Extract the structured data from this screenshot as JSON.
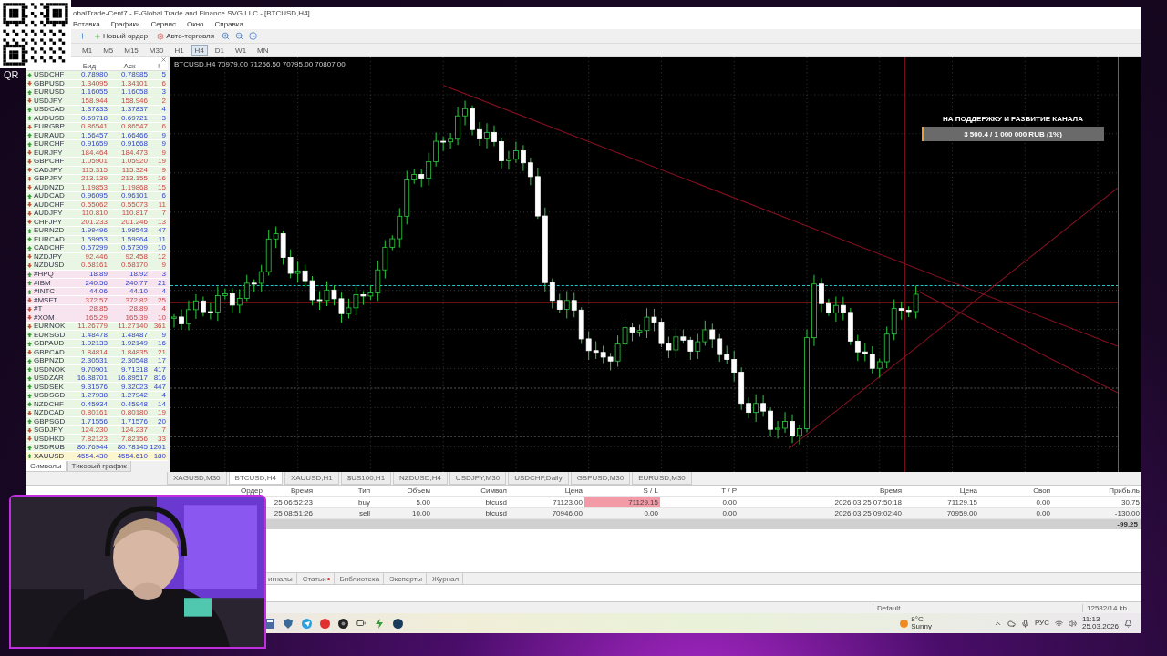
{
  "title_bar": {
    "title": "obalTrade-Cent7 - E-Global Trade and Finance SVG LLC - [BTCUSD,H4]"
  },
  "menu": [
    "Вставка",
    "Графики",
    "Сервис",
    "Окно",
    "Справка"
  ],
  "toolbar": {
    "new_order": "Новый ордер",
    "auto_trading": "Авто-торговля"
  },
  "timeframes": [
    {
      "label": "M1",
      "selected": false
    },
    {
      "label": "M5",
      "selected": false
    },
    {
      "label": "M15",
      "selected": false
    },
    {
      "label": "M30",
      "selected": false
    },
    {
      "label": "H1",
      "selected": false
    },
    {
      "label": "H4",
      "selected": true
    },
    {
      "label": "D1",
      "selected": false
    },
    {
      "label": "W1",
      "selected": false
    },
    {
      "label": "MN",
      "selected": false
    }
  ],
  "market_watch": {
    "columns": [
      "Бид",
      "Аск",
      "!"
    ],
    "rows": [
      {
        "symbol": "USDCHF",
        "bid": "0.78980",
        "ask": "0.78985",
        "spread": "5",
        "up": true,
        "color": "#eaf6e4"
      },
      {
        "symbol": "GBPUSD",
        "bid": "1.34095",
        "ask": "1.34101",
        "spread": "6",
        "up": false,
        "color": "#eaf6e4"
      },
      {
        "symbol": "EURUSD",
        "bid": "1.16055",
        "ask": "1.16058",
        "spread": "3",
        "up": true,
        "color": "#eaf6e4"
      },
      {
        "symbol": "USDJPY",
        "bid": "158.944",
        "ask": "158.946",
        "spread": "2",
        "up": false,
        "color": "#eaf6e4"
      },
      {
        "symbol": "USDCAD",
        "bid": "1.37833",
        "ask": "1.37837",
        "spread": "4",
        "up": true,
        "color": "#eaf6e4"
      },
      {
        "symbol": "AUDUSD",
        "bid": "0.69718",
        "ask": "0.69721",
        "spread": "3",
        "up": true,
        "color": "#eaf6e4"
      },
      {
        "symbol": "EURGBP",
        "bid": "0.86541",
        "ask": "0.86547",
        "spread": "6",
        "up": false,
        "color": "#eaf6e4"
      },
      {
        "symbol": "EURAUD",
        "bid": "1.66457",
        "ask": "1.66466",
        "spread": "9",
        "up": true,
        "color": "#eaf6e4"
      },
      {
        "symbol": "EURCHF",
        "bid": "0.91659",
        "ask": "0.91668",
        "spread": "9",
        "up": true,
        "color": "#eaf6e4"
      },
      {
        "symbol": "EURJPY",
        "bid": "184.464",
        "ask": "184.473",
        "spread": "9",
        "up": false,
        "color": "#eaf6e4"
      },
      {
        "symbol": "GBPCHF",
        "bid": "1.05901",
        "ask": "1.05920",
        "spread": "19",
        "up": false,
        "color": "#eaf6e4"
      },
      {
        "symbol": "CADJPY",
        "bid": "115.315",
        "ask": "115.324",
        "spread": "9",
        "up": false,
        "color": "#eaf6e4"
      },
      {
        "symbol": "GBPJPY",
        "bid": "213.139",
        "ask": "213.155",
        "spread": "16",
        "up": false,
        "color": "#eaf6e4"
      },
      {
        "symbol": "AUDNZD",
        "bid": "1.19853",
        "ask": "1.19868",
        "spread": "15",
        "up": false,
        "color": "#eaf6e4"
      },
      {
        "symbol": "AUDCAD",
        "bid": "0.96095",
        "ask": "0.96101",
        "spread": "6",
        "up": true,
        "color": "#eaf6e4"
      },
      {
        "symbol": "AUDCHF",
        "bid": "0.55062",
        "ask": "0.55073",
        "spread": "11",
        "up": false,
        "color": "#eaf6e4"
      },
      {
        "symbol": "AUDJPY",
        "bid": "110.810",
        "ask": "110.817",
        "spread": "7",
        "up": false,
        "color": "#eaf6e4"
      },
      {
        "symbol": "CHFJPY",
        "bid": "201.233",
        "ask": "201.246",
        "spread": "13",
        "up": false,
        "color": "#eaf6e4"
      },
      {
        "symbol": "EURNZD",
        "bid": "1.99496",
        "ask": "1.99543",
        "spread": "47",
        "up": true,
        "color": "#eaf6e4"
      },
      {
        "symbol": "EURCAD",
        "bid": "1.59953",
        "ask": "1.59964",
        "spread": "11",
        "up": true,
        "color": "#eaf6e4"
      },
      {
        "symbol": "CADCHF",
        "bid": "0.57299",
        "ask": "0.57309",
        "spread": "10",
        "up": true,
        "color": "#eaf6e4"
      },
      {
        "symbol": "NZDJPY",
        "bid": "92.446",
        "ask": "92.458",
        "spread": "12",
        "up": false,
        "color": "#eaf6e4"
      },
      {
        "symbol": "NZDUSD",
        "bid": "0.58161",
        "ask": "0.58170",
        "spread": "9",
        "up": false,
        "color": "#eaf6e4"
      },
      {
        "symbol": "#HPQ",
        "bid": "18.89",
        "ask": "18.92",
        "spread": "3",
        "up": true,
        "color": "#f8e4ee"
      },
      {
        "symbol": "#IBM",
        "bid": "240.56",
        "ask": "240.77",
        "spread": "21",
        "up": true,
        "color": "#f8e4ee"
      },
      {
        "symbol": "#INTC",
        "bid": "44.06",
        "ask": "44.10",
        "spread": "4",
        "up": true,
        "color": "#f8e4ee"
      },
      {
        "symbol": "#MSFT",
        "bid": "372.57",
        "ask": "372.82",
        "spread": "25",
        "up": false,
        "color": "#f8e4ee"
      },
      {
        "symbol": "#T",
        "bid": "28.85",
        "ask": "28.89",
        "spread": "4",
        "up": false,
        "color": "#f8e4ee"
      },
      {
        "symbol": "#XOM",
        "bid": "165.29",
        "ask": "165.39",
        "spread": "10",
        "up": false,
        "color": "#f8e4ee"
      },
      {
        "symbol": "EURNOK",
        "bid": "11.26779",
        "ask": "11.27140",
        "spread": "361",
        "up": false,
        "color": "#eaf6e4"
      },
      {
        "symbol": "EURSGD",
        "bid": "1.48478",
        "ask": "1.48487",
        "spread": "9",
        "up": true,
        "color": "#eaf6e4"
      },
      {
        "symbol": "GBPAUD",
        "bid": "1.92133",
        "ask": "1.92149",
        "spread": "16",
        "up": true,
        "color": "#eaf6e4"
      },
      {
        "symbol": "GBPCAD",
        "bid": "1.84814",
        "ask": "1.84835",
        "spread": "21",
        "up": false,
        "color": "#eaf6e4"
      },
      {
        "symbol": "GBPNZD",
        "bid": "2.30531",
        "ask": "2.30548",
        "spread": "17",
        "up": true,
        "color": "#eaf6e4"
      },
      {
        "symbol": "USDNOK",
        "bid": "9.70901",
        "ask": "9.71318",
        "spread": "417",
        "up": true,
        "color": "#eaf6e4"
      },
      {
        "symbol": "USDZAR",
        "bid": "16.88701",
        "ask": "16.89517",
        "spread": "816",
        "up": true,
        "color": "#eaf6e4"
      },
      {
        "symbol": "USDSEK",
        "bid": "9.31576",
        "ask": "9.32023",
        "spread": "447",
        "up": true,
        "color": "#eaf6e4"
      },
      {
        "symbol": "USDSGD",
        "bid": "1.27938",
        "ask": "1.27942",
        "spread": "4",
        "up": true,
        "color": "#eaf6e4"
      },
      {
        "symbol": "NZDCHF",
        "bid": "0.45934",
        "ask": "0.45948",
        "spread": "14",
        "up": true,
        "color": "#eaf6e4"
      },
      {
        "symbol": "NZDCAD",
        "bid": "0.80161",
        "ask": "0.80180",
        "spread": "19",
        "up": false,
        "color": "#eaf6e4"
      },
      {
        "symbol": "GBPSGD",
        "bid": "1.71556",
        "ask": "1.71576",
        "spread": "20",
        "up": true,
        "color": "#eaf6e4"
      },
      {
        "symbol": "SGDJPY",
        "bid": "124.230",
        "ask": "124.237",
        "spread": "7",
        "up": false,
        "color": "#eaf6e4"
      },
      {
        "symbol": "USDHKD",
        "bid": "7.82123",
        "ask": "7.82156",
        "spread": "33",
        "up": false,
        "color": "#eaf6e4"
      },
      {
        "symbol": "USDRUB",
        "bid": "80.76944",
        "ask": "80.78145",
        "spread": "1201",
        "up": true,
        "color": "#eaf6e4"
      },
      {
        "symbol": "XAUUSD",
        "bid": "4554.430",
        "ask": "4554.610",
        "spread": "180",
        "up": true,
        "color": "#fbf6cf"
      }
    ],
    "tabs": [
      {
        "label": "Символы",
        "selected": true
      },
      {
        "label": "Тиковый график",
        "selected": false
      }
    ]
  },
  "chart": {
    "info": "BTCUSD,H4  70979.00 71256.50 70795.00 70807.00",
    "donation": {
      "title": "НА ПОДДЕРЖКУ И РАЗВИТИЕ КАНАЛА",
      "amount": "3 500.4 / 1 000 000 RUB (1%)",
      "level": 0.01
    }
  },
  "chart_tabs": [
    {
      "label": "XAGUSD,M30",
      "selected": false
    },
    {
      "label": "BTCUSD,H4",
      "selected": true
    },
    {
      "label": "XAUUSD,H1",
      "selected": false
    },
    {
      "label": "$US100,H1",
      "selected": false
    },
    {
      "label": "NZDUSD,H4",
      "selected": false
    },
    {
      "label": "USDJPY,M30",
      "selected": false
    },
    {
      "label": "USDCHF,Daily",
      "selected": false
    },
    {
      "label": "GBPUSD,M30",
      "selected": false
    },
    {
      "label": "EURUSD,M30",
      "selected": false
    }
  ],
  "terminal": {
    "columns": [
      "Ордер",
      "Время",
      "Тип",
      "Объем",
      "Символ",
      "Цена",
      "S / L",
      "T / P",
      "Время",
      "Цена",
      "Своп",
      "Прибыль"
    ],
    "rows": [
      {
        "cells": [
          "",
          "25 06:52:23",
          "buy",
          "5.00",
          "btcusd",
          "71123.00",
          "71129.15",
          "0.00",
          "2026.03.25 07:50:18",
          "71129.15",
          "0.00",
          "30.75"
        ],
        "sl_alert": true
      },
      {
        "cells": [
          "",
          "25 08:51:26",
          "sell",
          "10.00",
          "btcusd",
          "70946.00",
          "0.00",
          "0.00",
          "2026.03.25 09:02:40",
          "70959.00",
          "0.00",
          "-130.00"
        ],
        "sl_alert": false
      }
    ],
    "total": "-99.25",
    "tabs": [
      {
        "label": "игналы",
        "marked": false
      },
      {
        "label": "Статьи",
        "marked": true
      },
      {
        "label": "Библиотека",
        "marked": false
      },
      {
        "label": "Эксперты",
        "marked": false
      },
      {
        "label": "Журнал",
        "marked": false
      }
    ]
  },
  "status_bar": {
    "profile": "Default",
    "traffic": "12582/14 kb"
  },
  "taskbar": {
    "temperature": "8°C",
    "condition": "Sunny",
    "language": "РУС",
    "time": "11:13",
    "date": "25.03.2026"
  },
  "overlay": {
    "qr_label": "QR"
  }
}
